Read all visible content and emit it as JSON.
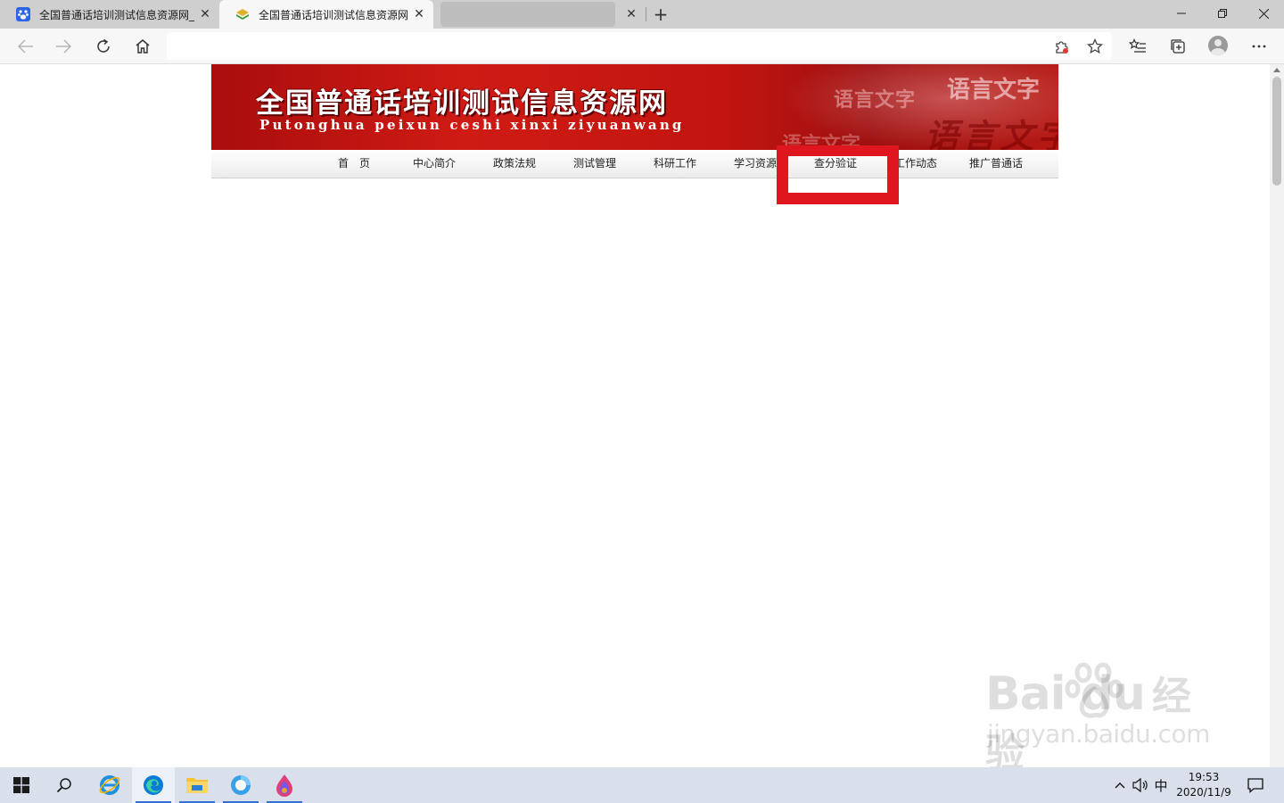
{
  "browser": {
    "tabs": [
      {
        "title": "全国普通话培训测试信息资源网_",
        "favicon": "baidu-paw-icon",
        "active": false
      },
      {
        "title": "全国普通话培训测试信息资源网",
        "favicon": "site-book-icon",
        "active": true
      },
      {
        "title": "",
        "favicon": "",
        "active": false
      }
    ],
    "address": {
      "value": ""
    },
    "window_controls": {
      "minimize": "—",
      "restore": "❐",
      "close": "✕"
    }
  },
  "page": {
    "banner": {
      "title": "全国普通话培训测试信息资源网",
      "subtitle": "Putonghua peixun ceshi xinxi ziyuanwang",
      "deco": [
        "语言文字",
        "语言文字",
        "语言文字",
        "语言文字"
      ]
    },
    "nav": {
      "items": [
        "首　页",
        "中心简介",
        "政策法规",
        "测试管理",
        "科研工作",
        "学习资源",
        "查分验证",
        "工作动态",
        "推广普通话"
      ]
    },
    "highlight_color": "#e0161f"
  },
  "watermark": {
    "brand": "Bai du",
    "cn": "经验",
    "url": "jingyan.baidu.com"
  },
  "taskbar": {
    "apps": [
      "windows-start-icon",
      "search-icon",
      "ie-icon",
      "edge-icon",
      "file-explorer-icon",
      "browser-app-icon",
      "paint-drop-icon"
    ],
    "tray": {
      "ime": "中"
    },
    "clock": {
      "time": "19:53",
      "date": "2020/11/9"
    }
  }
}
